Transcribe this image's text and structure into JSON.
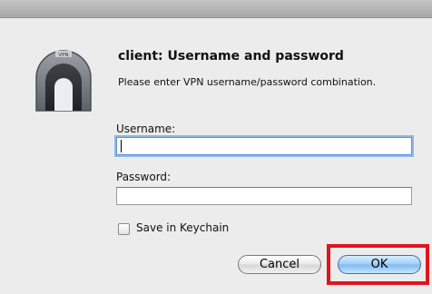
{
  "dialog": {
    "title": "client: Username and password",
    "message": "Please enter VPN username/password combination.",
    "icon_name": "vpn-tunnel-icon",
    "icon_badge": "VPN"
  },
  "form": {
    "username_label": "Username:",
    "username_value": "",
    "password_label": "Password:",
    "password_value": "",
    "keychain_label": "Save in Keychain",
    "keychain_checked": false
  },
  "buttons": {
    "cancel_label": "Cancel",
    "ok_label": "OK"
  },
  "annotation": {
    "highlight_color": "#e0141d"
  }
}
